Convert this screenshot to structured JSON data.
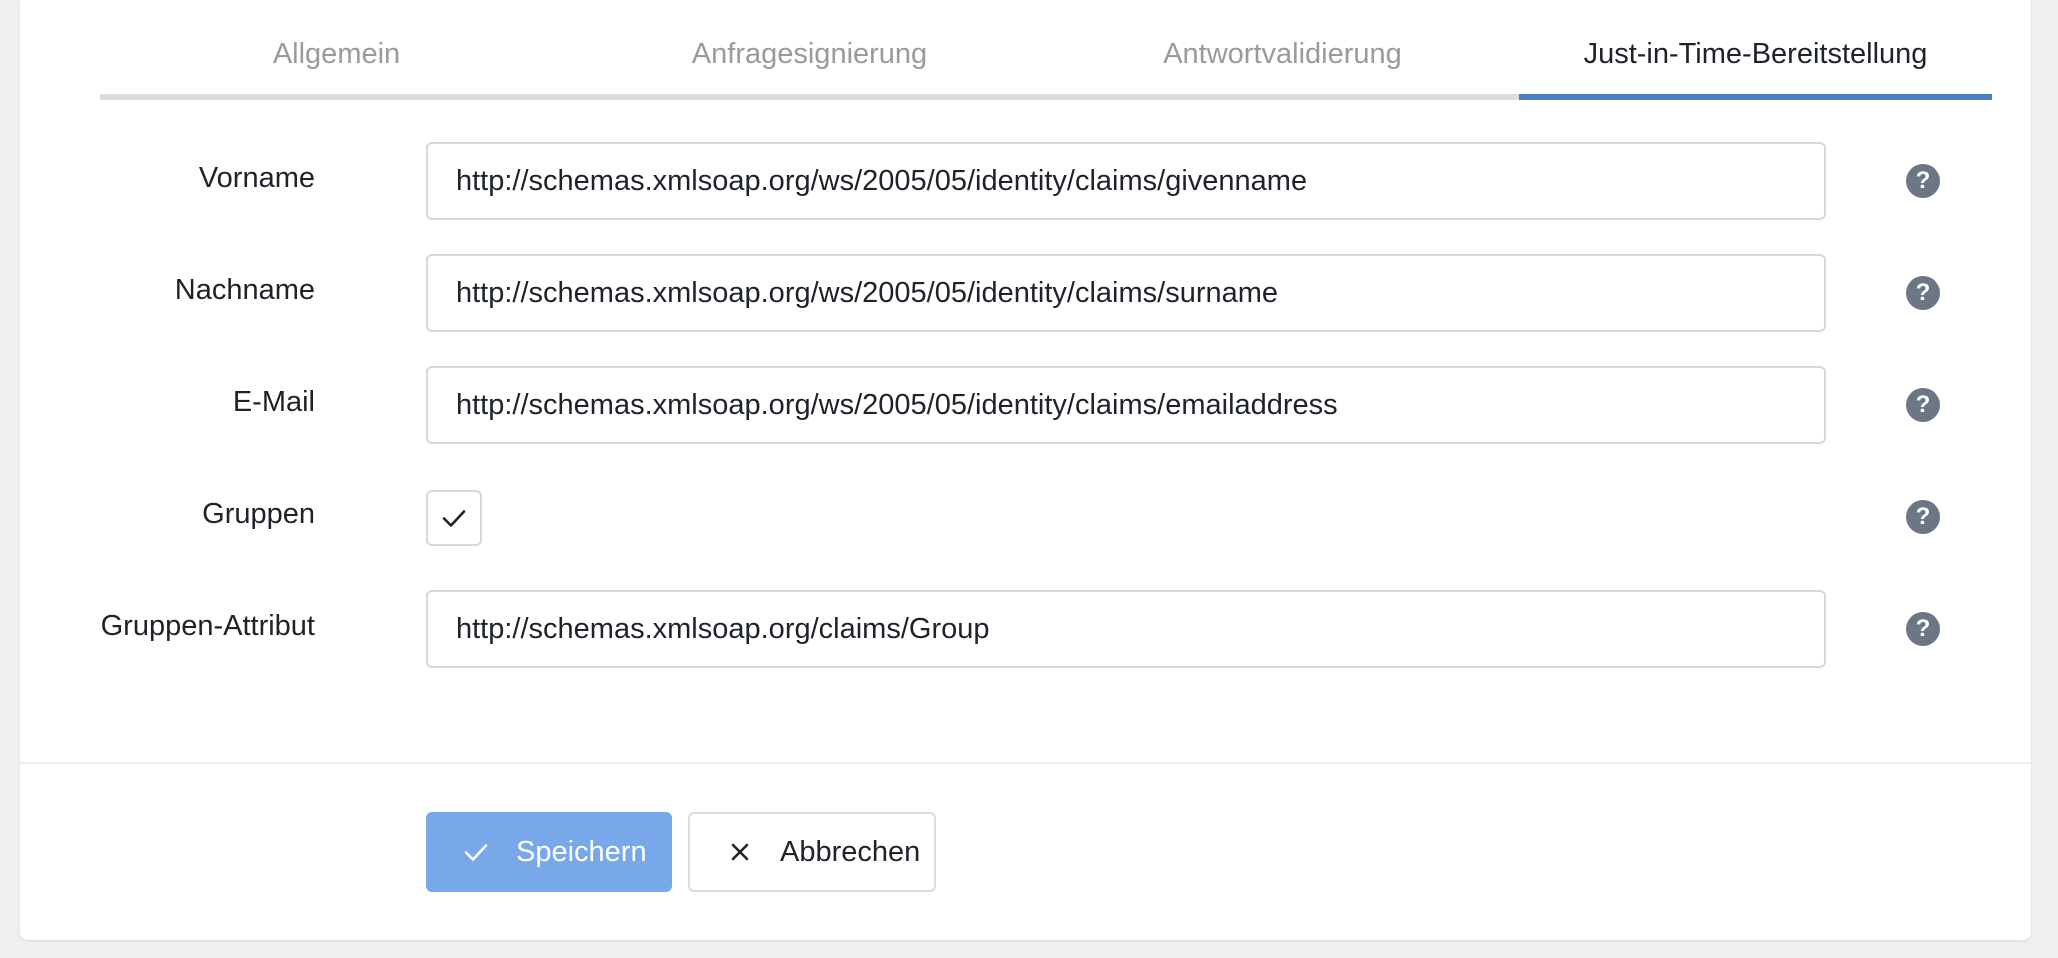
{
  "tabs": [
    {
      "label": "Allgemein",
      "active": false
    },
    {
      "label": "Anfragesignierung",
      "active": false
    },
    {
      "label": "Antwortvalidierung",
      "active": false
    },
    {
      "label": "Just-in-Time-Bereitstellung",
      "active": true
    }
  ],
  "form": {
    "first_name": {
      "label": "Vorname",
      "value": "http://schemas.xmlsoap.org/ws/2005/05/identity/claims/givenname"
    },
    "last_name": {
      "label": "Nachname",
      "value": "http://schemas.xmlsoap.org/ws/2005/05/identity/claims/surname"
    },
    "email": {
      "label": "E-Mail",
      "value": "http://schemas.xmlsoap.org/ws/2005/05/identity/claims/emailaddress"
    },
    "groups": {
      "label": "Gruppen",
      "checked": true
    },
    "group_attribute": {
      "label": "Gruppen-Attribut",
      "value": "http://schemas.xmlsoap.org/claims/Group"
    },
    "help_icon_glyph": "?"
  },
  "actions": {
    "save_label": "Speichern",
    "cancel_label": "Abbrechen"
  },
  "colors": {
    "accent": "#4a80c2",
    "save_button": "#79a8ea",
    "help_icon": "#6c7684",
    "background": "#efefef"
  },
  "icons": {
    "save": "check-icon",
    "cancel": "close-icon",
    "groups_checkbox": "check-icon",
    "help": "help-circle-icon"
  }
}
